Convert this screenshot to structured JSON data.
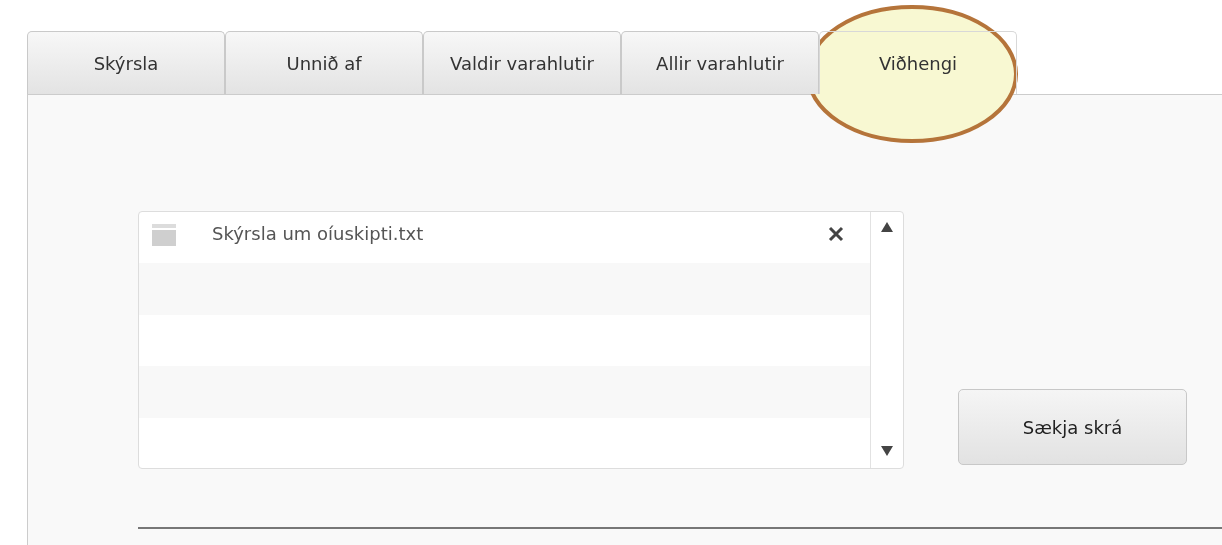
{
  "tabs": [
    {
      "label": "Skýrsla",
      "selected": false,
      "highlighted": false
    },
    {
      "label": "Unnið af",
      "selected": false,
      "highlighted": false
    },
    {
      "label": "Valdir varahlutir",
      "selected": false,
      "highlighted": false
    },
    {
      "label": "Allir varahlutir",
      "selected": false,
      "highlighted": false
    },
    {
      "label": "Viðhengi",
      "selected": true,
      "highlighted": true
    }
  ],
  "attachments": [
    {
      "name": "Skýrsla um oíuskipti.txt"
    }
  ],
  "download_button": "Sækja skrá"
}
